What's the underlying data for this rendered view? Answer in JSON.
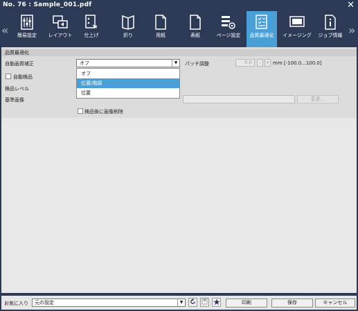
{
  "window": {
    "title": "No. 76 : Sample_001.pdf",
    "close_glyph": "✕"
  },
  "toolbar": {
    "prev_glyph": "«",
    "next_glyph": "»",
    "items": [
      {
        "label": "簡易設定",
        "icon": "sliders-icon"
      },
      {
        "label": "レイアウト",
        "icon": "layout-icon"
      },
      {
        "label": "仕上げ",
        "icon": "finishing-icon"
      },
      {
        "label": "折り",
        "icon": "fold-icon"
      },
      {
        "label": "用紙",
        "icon": "paper-icon"
      },
      {
        "label": "表紙",
        "icon": "cover-icon"
      },
      {
        "label": "ページ設定",
        "icon": "page-settings-icon"
      },
      {
        "label": "品質最適化",
        "icon": "quality-icon",
        "active": true
      },
      {
        "label": "イメージング",
        "icon": "imaging-icon"
      },
      {
        "label": "ジョブ情報",
        "icon": "job-info-icon"
      }
    ]
  },
  "section": {
    "title": "品質最適化",
    "auto_correction_label": "自動画質補正",
    "auto_correction_value": "オフ",
    "dropdown_options": [
      "オフ",
      "位置/階調",
      "位置"
    ],
    "selected_option_index": 1,
    "patch_label": "パッチ調整",
    "patch_value": "0.0",
    "minus_label": "–",
    "plus_label": "+",
    "patch_unit": "mm [-100.0...100.0]",
    "auto_inspect_label": "自動検品",
    "inspect_level_label": "検品レベル",
    "reference_image_label": "基準画像",
    "change_button": "変更...",
    "delete_after_inspect_label": "検品後に画像削除"
  },
  "footer": {
    "favorites_label": "お気に入り",
    "favorites_value": "元の設定",
    "print_button": "印刷",
    "save_button": "保存",
    "cancel_button": "キャンセル"
  },
  "colors": {
    "titlebar": "#2d3a55",
    "accent": "#4a9fd6",
    "panel": "#dcdcdc"
  }
}
